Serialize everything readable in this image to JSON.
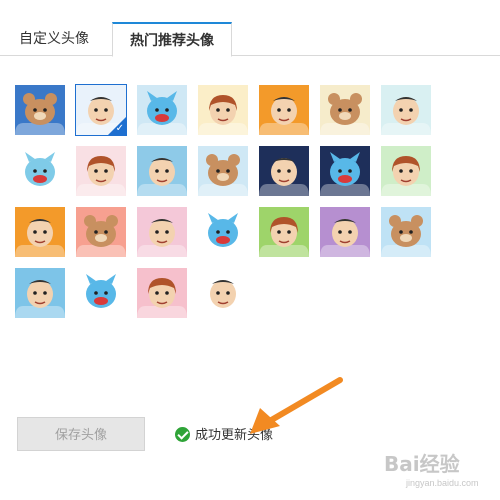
{
  "tabs": [
    {
      "label": "自定义头像",
      "active": false
    },
    {
      "label": "热门推荐头像",
      "active": true
    }
  ],
  "colors": {
    "accent": "#1e88d8",
    "selected_border": "#1e6fd0",
    "success": "#2fa438",
    "arrow": "#f28a22"
  },
  "avatars": [
    {
      "name": "bear-icon",
      "bg": "#3a78c8",
      "face": "#c89060",
      "selected": false
    },
    {
      "name": "boy-glasses-icon",
      "bg": "#e9f2fb",
      "face": "#f3d2b0",
      "selected": true
    },
    {
      "name": "blue-bird-icon",
      "bg": "#cfe8f5",
      "face": "#58b8e8",
      "selected": false
    },
    {
      "name": "girl-eating-icon",
      "bg": "#fbeec8",
      "face": "#f3d2b0",
      "selected": false
    },
    {
      "name": "laughing-boy-icon",
      "bg": "#f39a2a",
      "face": "#f3d2b0",
      "selected": false
    },
    {
      "name": "bear-icon",
      "bg": "#f6eccb",
      "face": "#c89060",
      "selected": false
    },
    {
      "name": "boy-icon",
      "bg": "#d9f0f2",
      "face": "#f3d2b0",
      "selected": false
    },
    {
      "name": "blue-bird-icon",
      "bg": "#ffffff",
      "face": "#7fcbe8",
      "selected": false
    },
    {
      "name": "girl-icon",
      "bg": "#f9e0e4",
      "face": "#f3d2b0",
      "selected": false
    },
    {
      "name": "boy-smile-icon",
      "bg": "#8ecae8",
      "face": "#f3d2b0",
      "selected": false
    },
    {
      "name": "bear-icon",
      "bg": "#cfe8f5",
      "face": "#c89060",
      "selected": false
    },
    {
      "name": "boy-glasses-icon",
      "bg": "#1e2f5a",
      "face": "#f3d2b0",
      "selected": false
    },
    {
      "name": "blue-bird-icon",
      "bg": "#1e2f5a",
      "face": "#58b8e8",
      "selected": false
    },
    {
      "name": "girl-sunglasses-icon",
      "bg": "#cfeec8",
      "face": "#f3d2b0",
      "selected": false
    },
    {
      "name": "boy-duck-icon",
      "bg": "#f39a2a",
      "face": "#f3d2b0",
      "selected": false
    },
    {
      "name": "bear-icon",
      "bg": "#f7a090",
      "face": "#c89060",
      "selected": false
    },
    {
      "name": "boy-icon",
      "bg": "#f4c8d8",
      "face": "#f3d2b0",
      "selected": false
    },
    {
      "name": "blue-bird-icon",
      "bg": "#ffffff",
      "face": "#58b8e8",
      "selected": false
    },
    {
      "name": "girl-icon",
      "bg": "#9ed46a",
      "face": "#f3d2b0",
      "selected": false
    },
    {
      "name": "boy-icon",
      "bg": "#b68fd0",
      "face": "#f3d2b0",
      "selected": false
    },
    {
      "name": "bear-icon",
      "bg": "#bfe2f5",
      "face": "#c89060",
      "selected": false
    },
    {
      "name": "boy-glasses-icon",
      "bg": "#7dc4e8",
      "face": "#f3d2b0",
      "selected": false
    },
    {
      "name": "blue-bird-icon",
      "bg": "#ffffff",
      "face": "#58b8e8",
      "selected": false
    },
    {
      "name": "girl-icon",
      "bg": "#f6c0cc",
      "face": "#f3d2b0",
      "selected": false
    },
    {
      "name": "boy-icon",
      "bg": "#ffffff",
      "face": "#f3d2b0",
      "selected": false
    }
  ],
  "save_button": {
    "label": "保存头像"
  },
  "status": {
    "text": "成功更新头像"
  },
  "watermark": {
    "brand": "Bai经验",
    "url": "jingyan.baidu.com"
  }
}
